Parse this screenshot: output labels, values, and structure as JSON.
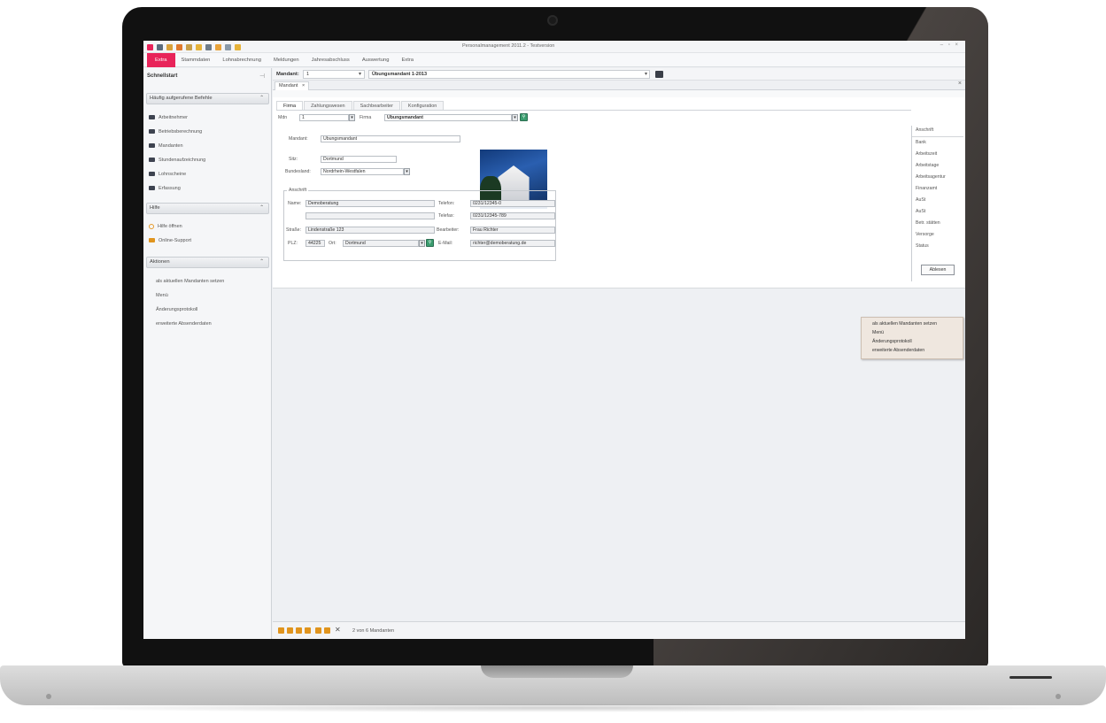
{
  "window": {
    "title": "Personalmanagement 2011.2 - Testversion",
    "controls": "– ▫ ×"
  },
  "menu": {
    "items": [
      "Extra",
      "Stammdaten",
      "Lohnabrechnung",
      "Meldungen",
      "Jahresabschluss",
      "Auswertung",
      "Extra"
    ]
  },
  "sidebar": {
    "header": "Schnellstart",
    "group1": "Häufig aufgerufene Befehle",
    "group1_items": [
      "Arbeitnehmer",
      "Betriebsberechnung",
      "Mandanten",
      "Stundenaufzeichnung",
      "Lohnscheine",
      "Erfassung"
    ],
    "group2": "Hilfe",
    "group2_items": [
      "Hilfe öffnen",
      "Online-Support"
    ],
    "group3": "Aktionen",
    "group3_items": [
      "als aktuellen Mandanten setzen",
      "Menü",
      "Änderungsprotokoll",
      "erweiterte Absenderdaten"
    ]
  },
  "toolbar": {
    "mandant_label": "Mandant:",
    "mandant_value": "1",
    "mandant_name": "Übungsmandant 1-2013"
  },
  "doc_tab": {
    "label": "Mandant",
    "close": "×"
  },
  "form": {
    "tabs": [
      "Firma",
      "Zahlungswesen",
      "Sachbearbeiter",
      "Konfiguration"
    ],
    "mdn_label": "Mdn",
    "mdn_value": "1",
    "firma_label": "Firma",
    "firma_value": "Übungsmandant",
    "mandant_label": "Mandant:",
    "mandant_value": "Übungsmandant",
    "sitz_label": "Sitz:",
    "sitz_value": "Dortmund",
    "bundesland_label": "Bundesland:",
    "bundesland_value": "Nordrhein-Westfalen",
    "anschrift_title": "Anschrift",
    "name_label": "Name:",
    "name_value": "Demoberatung",
    "name2_value": "",
    "strasse_label": "Straße:",
    "strasse_value": "Lindenstraße 123",
    "plz_label": "PLZ:",
    "plz_value": "44225",
    "ort_label": "Ort:",
    "ort_value": "Dortmund",
    "telefon_label": "Telefon:",
    "telefon_value": "0231/12345-0",
    "telefax_label": "Telefax:",
    "telefax_value": "0231/12345-789",
    "bearbeiter_label": "Bearbeiter:",
    "bearbeiter_value": "Frau Richter",
    "email_label": "E-Mail:",
    "email_value": "richter@demoberatung.de"
  },
  "right_list": {
    "header": "Anschrift",
    "items": [
      "Bank",
      "Arbeitszeit",
      "Arbeitstage",
      "Arbeitsagentur",
      "Finanzamt",
      "AuSt",
      "AuSt",
      "Betr. stätten",
      "Versorge",
      "Status"
    ],
    "button": "Ablesen"
  },
  "popup": {
    "items": [
      "als aktuellen Mandanten setzen",
      "Menü",
      "Änderungsprotokoll",
      "erweiterte Absenderdaten"
    ]
  },
  "nav": {
    "status": "2 von 6 Mandanten"
  },
  "colors": {
    "accent": "#e8245a",
    "nav_icon": "#e0941d",
    "search_button": "#3b9d6f"
  }
}
